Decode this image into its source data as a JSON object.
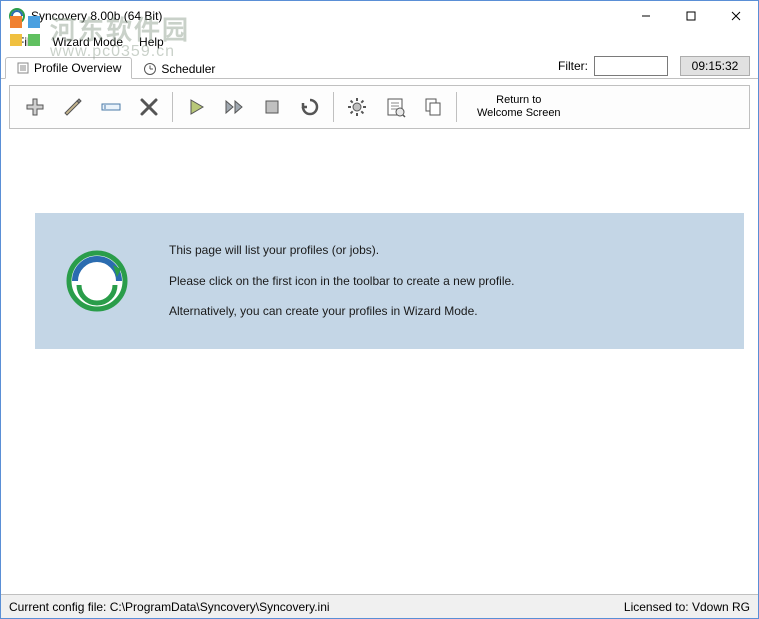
{
  "window": {
    "title": "Syncovery 8.00b (64 Bit)"
  },
  "menubar": {
    "file": "File",
    "wizard_mode": "Wizard Mode",
    "help": "Help"
  },
  "tabs": {
    "profile_overview": "Profile Overview",
    "scheduler": "Scheduler"
  },
  "filter": {
    "label": "Filter:",
    "value": ""
  },
  "clock": "09:15:32",
  "toolbar": {
    "return_line1": "Return to",
    "return_line2": "Welcome Screen"
  },
  "info": {
    "line1": "This page will list your profiles (or jobs).",
    "line2": "Please click on the first icon in the toolbar to create a new profile.",
    "line3": "Alternatively, you can create your profiles in Wizard Mode."
  },
  "statusbar": {
    "config_file": "Current config file: C:\\ProgramData\\Syncovery\\Syncovery.ini",
    "licensed_to": "Licensed to: Vdown RG"
  },
  "watermark": {
    "text": "河东软件园",
    "url": "www.pc0359.cn"
  }
}
